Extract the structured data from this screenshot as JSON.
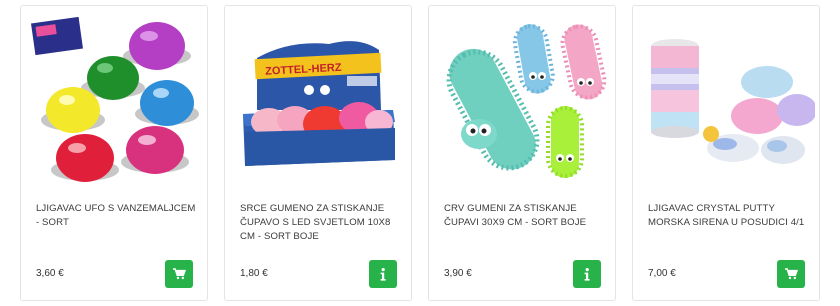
{
  "products": [
    {
      "title": "LJIGAVAC UFO S VANZEMALJCEM - SORT",
      "price": "3,60 €",
      "action": "cart-icon"
    },
    {
      "title": "SRCE GUMENO ZA STISKANJE ČUPAVO S LED SVJETLOM 10x8 cm - SORT BOJE",
      "price": "1,80 €",
      "action": "info-icon",
      "box_label": "ZOTTEL-HERZ"
    },
    {
      "title": "CRV GUMENI ZA STISKANJE ČUPAVI 30x9 cm - SORT BOJE",
      "price": "3,90 €",
      "action": "info-icon"
    },
    {
      "title": "LJIGAVAC CRYSTAL PUTTY MORSKA SIRENA U POSUDICI 4/1",
      "price": "7,00 €",
      "action": "cart-icon"
    }
  ],
  "colors": {
    "button": "#27b24a",
    "border": "#e4e4e4"
  }
}
